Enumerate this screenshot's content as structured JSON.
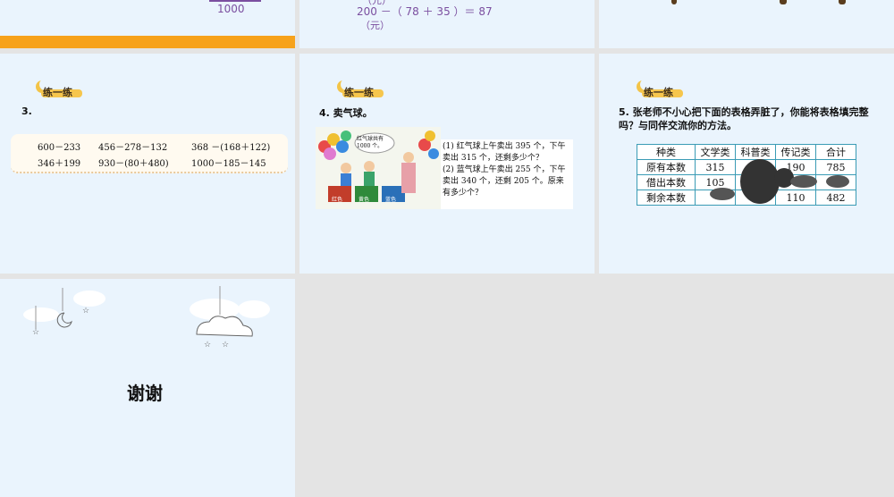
{
  "slide1": {
    "value": "1000"
  },
  "slide2": {
    "line_top": "（元）",
    "equation": "200 －（ 78 ＋ 35 ）＝ 87",
    "unit": "（元）"
  },
  "badge_label": "练一练",
  "q3": {
    "title": "3.",
    "row1": [
      "600－233",
      "456－278－132",
      "368 －(168＋122)"
    ],
    "row2": [
      "346＋199",
      "930－(80＋480)",
      "1000－185－145"
    ]
  },
  "q4": {
    "title": "4. 卖气球。",
    "bubble": "红气球共有1000 个。",
    "labels": [
      "红色",
      "黄色",
      "蓝色"
    ],
    "p1": "(1) 红气球上午卖出 395 个，下午卖出 315 个，还剩多少个？",
    "p2": "(2) 蓝气球上午卖出 255 个，下午卖出 340 个，还剩 205 个。原来有多少个？"
  },
  "q5": {
    "title": "5. 张老师不小心把下面的表格弄脏了，你能将表格填完整吗？与同伴交流你的方法。",
    "headers": [
      "种类",
      "文学类",
      "科普类",
      "传记类",
      "合计"
    ],
    "rows": [
      [
        "原有本数",
        "315",
        "",
        "190",
        "785"
      ],
      [
        "借出本数",
        "105",
        "",
        "",
        ""
      ],
      [
        "剩余本数",
        "",
        "",
        "110",
        "482"
      ]
    ]
  },
  "thanks": "谢谢",
  "colors": {
    "orange_bar": "#f7a21b",
    "purple_text": "#7b4fa0",
    "table_border": "#3a9bb5"
  }
}
